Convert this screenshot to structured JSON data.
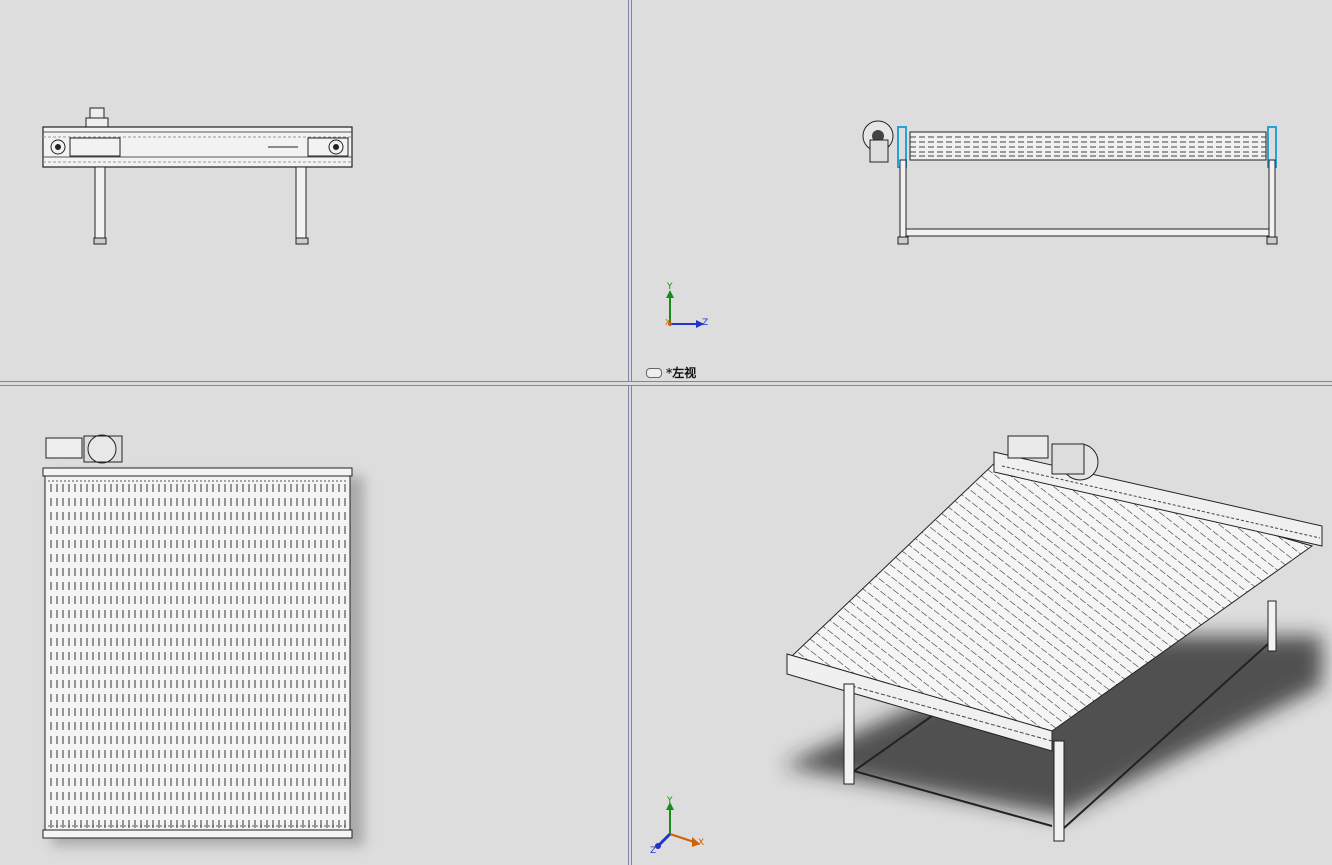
{
  "viewports": {
    "top_left": {
      "name": "front-view"
    },
    "top_right": {
      "name": "left-view",
      "label": "*左视",
      "axis": {
        "y": "Y",
        "z": "Z",
        "x": "X"
      }
    },
    "bottom_left": {
      "name": "top-view"
    },
    "bottom_right": {
      "name": "isometric-view",
      "axis": {
        "y": "Y",
        "z": "Z",
        "x": "X"
      }
    }
  },
  "colors": {
    "background": "#dddddd",
    "splitter": "#7c84a8",
    "line": "#222222",
    "axis_x": "#d06000",
    "axis_y": "#1a8a1a",
    "axis_z": "#2233cc",
    "bearing": "#2aa0d8"
  }
}
